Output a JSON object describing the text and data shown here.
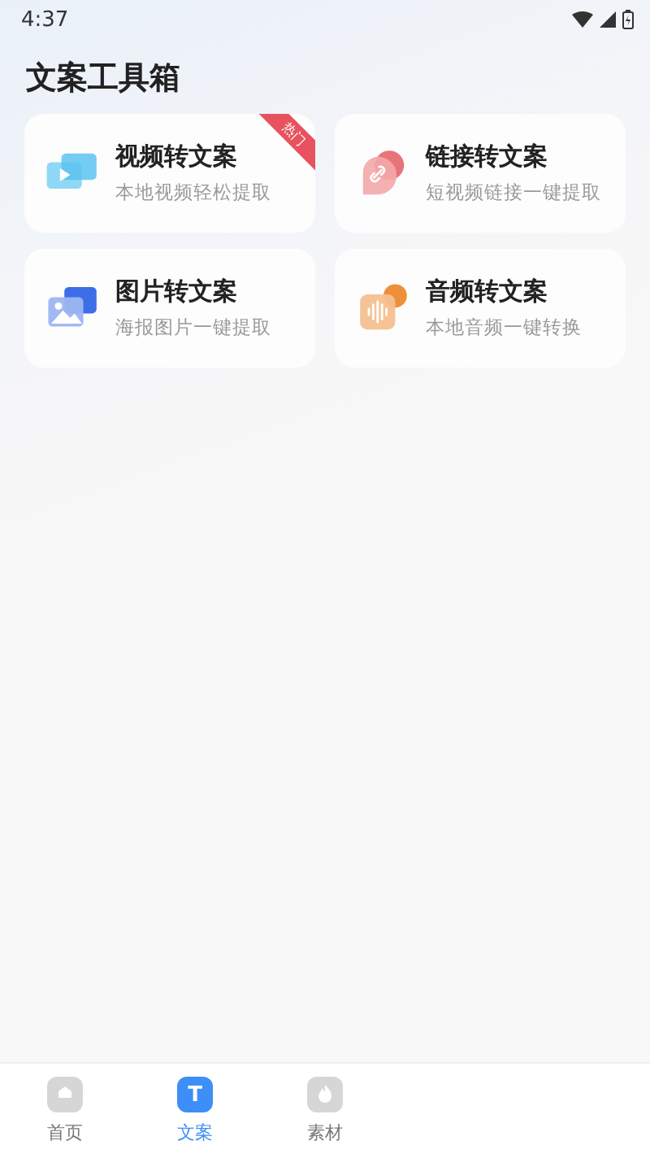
{
  "status_bar": {
    "time": "4:37"
  },
  "title": "文案工具箱",
  "tools": [
    {
      "kind": "video",
      "title": "视频转文案",
      "subtitle": "本地视频轻松提取",
      "badge": "热门"
    },
    {
      "kind": "link",
      "title": "链接转文案",
      "subtitle": "短视频链接一键提取"
    },
    {
      "kind": "image",
      "title": "图片转文案",
      "subtitle": "海报图片一键提取"
    },
    {
      "kind": "audio",
      "title": "音频转文案",
      "subtitle": "本地音频一键转换"
    }
  ],
  "nav": [
    {
      "kind": "home",
      "label": "首页",
      "selected": false
    },
    {
      "kind": "text",
      "label": "文案",
      "icon_text": "T",
      "selected": true
    },
    {
      "kind": "flame",
      "label": "素材",
      "selected": false
    }
  ]
}
